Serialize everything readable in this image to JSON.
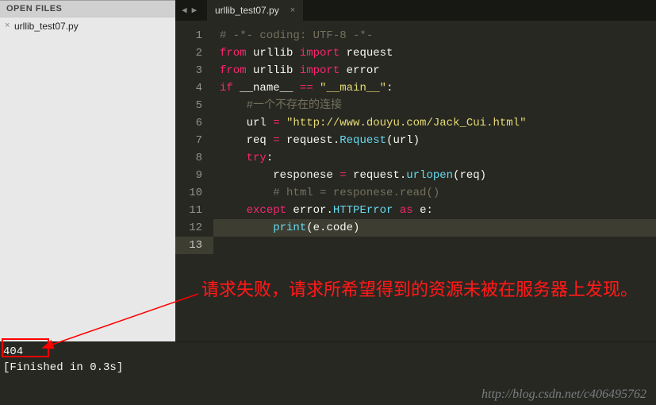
{
  "sidebar": {
    "header": "OPEN FILES",
    "files": [
      "urllib_test07.py"
    ]
  },
  "tabs": {
    "nav_prev": "◀",
    "nav_next": "▶",
    "items": [
      {
        "title": "urllib_test07.py",
        "close": "×"
      }
    ]
  },
  "code": {
    "lines": [
      {
        "n": "1",
        "tokens": [
          [
            "comment",
            "# -*- coding: UTF-8 -*-"
          ]
        ]
      },
      {
        "n": "2",
        "tokens": [
          [
            "keyword",
            "from"
          ],
          [
            "name",
            " urllib "
          ],
          [
            "keyword",
            "import"
          ],
          [
            "name",
            " request"
          ]
        ]
      },
      {
        "n": "3",
        "tokens": [
          [
            "keyword",
            "from"
          ],
          [
            "name",
            " urllib "
          ],
          [
            "keyword",
            "import"
          ],
          [
            "name",
            " error"
          ]
        ]
      },
      {
        "n": "4",
        "tokens": []
      },
      {
        "n": "5",
        "tokens": [
          [
            "keyword",
            "if"
          ],
          [
            "name",
            " __name__ "
          ],
          [
            "keyword",
            "=="
          ],
          [
            "name",
            " "
          ],
          [
            "string",
            "\"__main__\""
          ],
          [
            "name",
            ":"
          ]
        ]
      },
      {
        "n": "6",
        "indent": 1,
        "tokens": [
          [
            "comment",
            "#一个不存在的连接"
          ]
        ]
      },
      {
        "n": "7",
        "indent": 1,
        "tokens": [
          [
            "name",
            "url "
          ],
          [
            "keyword",
            "="
          ],
          [
            "name",
            " "
          ],
          [
            "string",
            "\"http://www.douyu.com/Jack_Cui.html\""
          ]
        ]
      },
      {
        "n": "8",
        "indent": 1,
        "tokens": [
          [
            "name",
            "req "
          ],
          [
            "keyword",
            "="
          ],
          [
            "name",
            " request."
          ],
          [
            "func",
            "Request"
          ],
          [
            "name",
            "(url)"
          ]
        ]
      },
      {
        "n": "9",
        "indent": 1,
        "tokens": [
          [
            "keyword",
            "try"
          ],
          [
            "name",
            ":"
          ]
        ]
      },
      {
        "n": "10",
        "indent": 2,
        "tokens": [
          [
            "name",
            "responese "
          ],
          [
            "keyword",
            "="
          ],
          [
            "name",
            " request."
          ],
          [
            "func",
            "urlopen"
          ],
          [
            "name",
            "(req)"
          ]
        ]
      },
      {
        "n": "11",
        "indent": 2,
        "tokens": [
          [
            "comment",
            "# html = responese.read()"
          ]
        ]
      },
      {
        "n": "12",
        "indent": 1,
        "tokens": [
          [
            "keyword",
            "except"
          ],
          [
            "name",
            " error."
          ],
          [
            "builtin",
            "HTTPError"
          ],
          [
            "name",
            " "
          ],
          [
            "keyword",
            "as"
          ],
          [
            "name",
            " e:"
          ]
        ]
      },
      {
        "n": "13",
        "indent": 2,
        "active": true,
        "tokens": [
          [
            "func",
            "print"
          ],
          [
            "name",
            "(e.code)"
          ]
        ]
      }
    ]
  },
  "console": {
    "line1": "404",
    "line2": "[Finished in 0.3s]"
  },
  "annotation": {
    "text": "请求失败，请求所希望得到的资源未被在服务器上发现。"
  },
  "watermark": "http://blog.csdn.net/c406495762"
}
